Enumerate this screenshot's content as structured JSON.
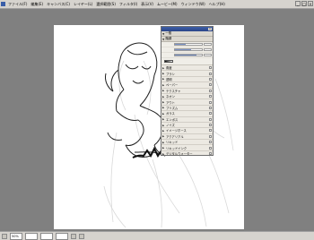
{
  "menubar": {
    "items": [
      "ファイル(F)",
      "編集(E)",
      "キャンバス(C)",
      "レイヤー(L)",
      "選択範囲(S)",
      "フィルタ(I)",
      "表示(V)",
      "ムービー(M)",
      "ウィンドウ(W)",
      "ヘルプ(H)"
    ]
  },
  "palette": {
    "sections": [
      "一般",
      "階調"
    ],
    "params": [
      {
        "label": "",
        "value": ""
      },
      {
        "label": "",
        "value": ""
      },
      {
        "label": "",
        "value": ""
      }
    ],
    "preset_label": "",
    "items": [
      "角度",
      "ブラシ",
      "透明",
      "ペーパー",
      "テクスチャ",
      "ネオン",
      "アウト",
      "プリズム",
      "ガラス",
      "エンボス",
      "ノイズ",
      "イメージホース",
      "アクアリアル",
      "リキッド",
      "リキッドインク",
      "デジタルウォーター",
      "デジタルタイル",
      "カラー変換"
    ]
  },
  "status": {
    "zoom": "50%",
    "fields": [
      "",
      "",
      ""
    ]
  },
  "colors": {
    "menubar_bg": "#d6d3ce",
    "workspace_bg": "#808080",
    "canvas_bg": "#ffffff",
    "palette_bg": "#f0eee8",
    "titlebar": "#2a4588"
  }
}
